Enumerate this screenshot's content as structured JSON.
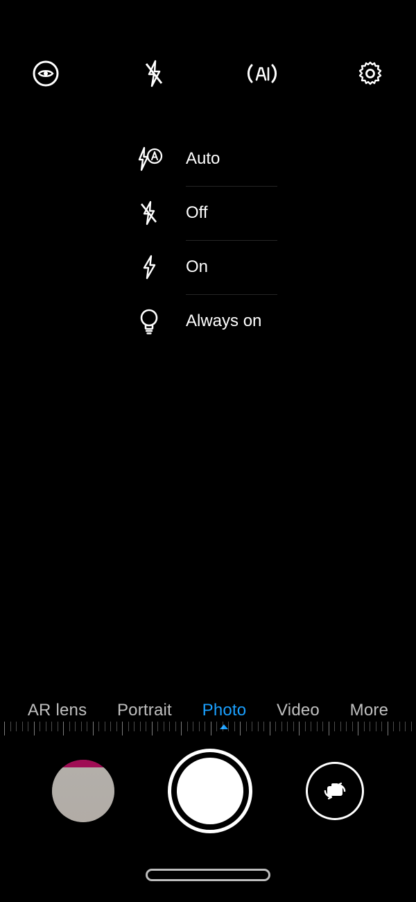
{
  "topbar": {
    "icons": [
      "eye-icon",
      "flash-off-icon",
      "ai-icon",
      "settings-icon"
    ]
  },
  "flash_menu": {
    "items": [
      {
        "label": "Auto",
        "icon": "flash-auto-icon"
      },
      {
        "label": "Off",
        "icon": "flash-off-icon"
      },
      {
        "label": "On",
        "icon": "flash-on-icon"
      },
      {
        "label": "Always on",
        "icon": "bulb-icon"
      }
    ]
  },
  "modes": {
    "items": [
      "AR lens",
      "Portrait",
      "Photo",
      "Video",
      "More"
    ],
    "active": "Photo"
  },
  "colors": {
    "accent": "#1aa0ff"
  }
}
